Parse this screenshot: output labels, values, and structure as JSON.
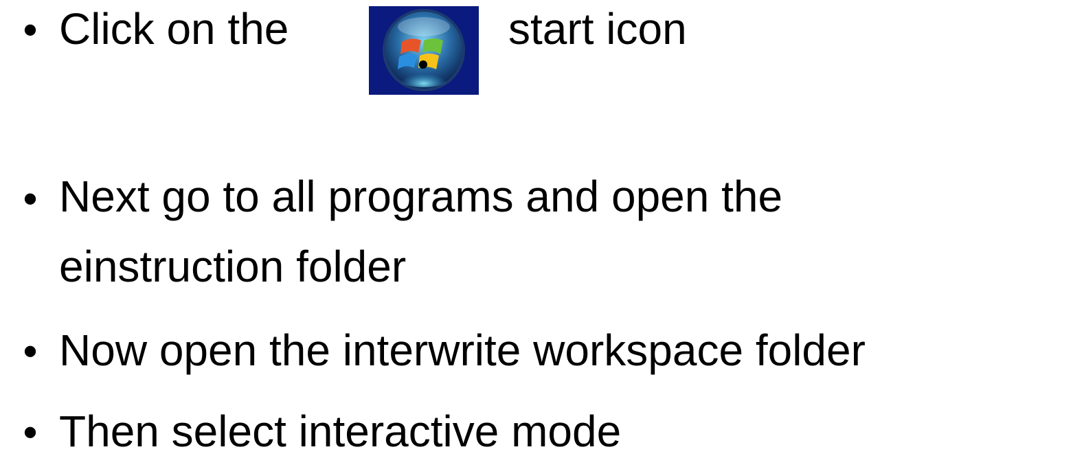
{
  "bullet_symbol": "•",
  "items": [
    {
      "text_before_icon": "Click on the",
      "icon": "windows-start-orb-icon",
      "text_after_icon": "start icon"
    },
    {
      "lines": [
        "Next go to all programs and open the",
        "einstruction folder"
      ]
    },
    {
      "lines": [
        "Now open the interwrite workspace folder"
      ]
    },
    {
      "lines": [
        "Then select interactive mode"
      ]
    }
  ],
  "colors": {
    "text": "#000000",
    "background": "#ffffff",
    "icon_background": "#0a1a7e"
  }
}
